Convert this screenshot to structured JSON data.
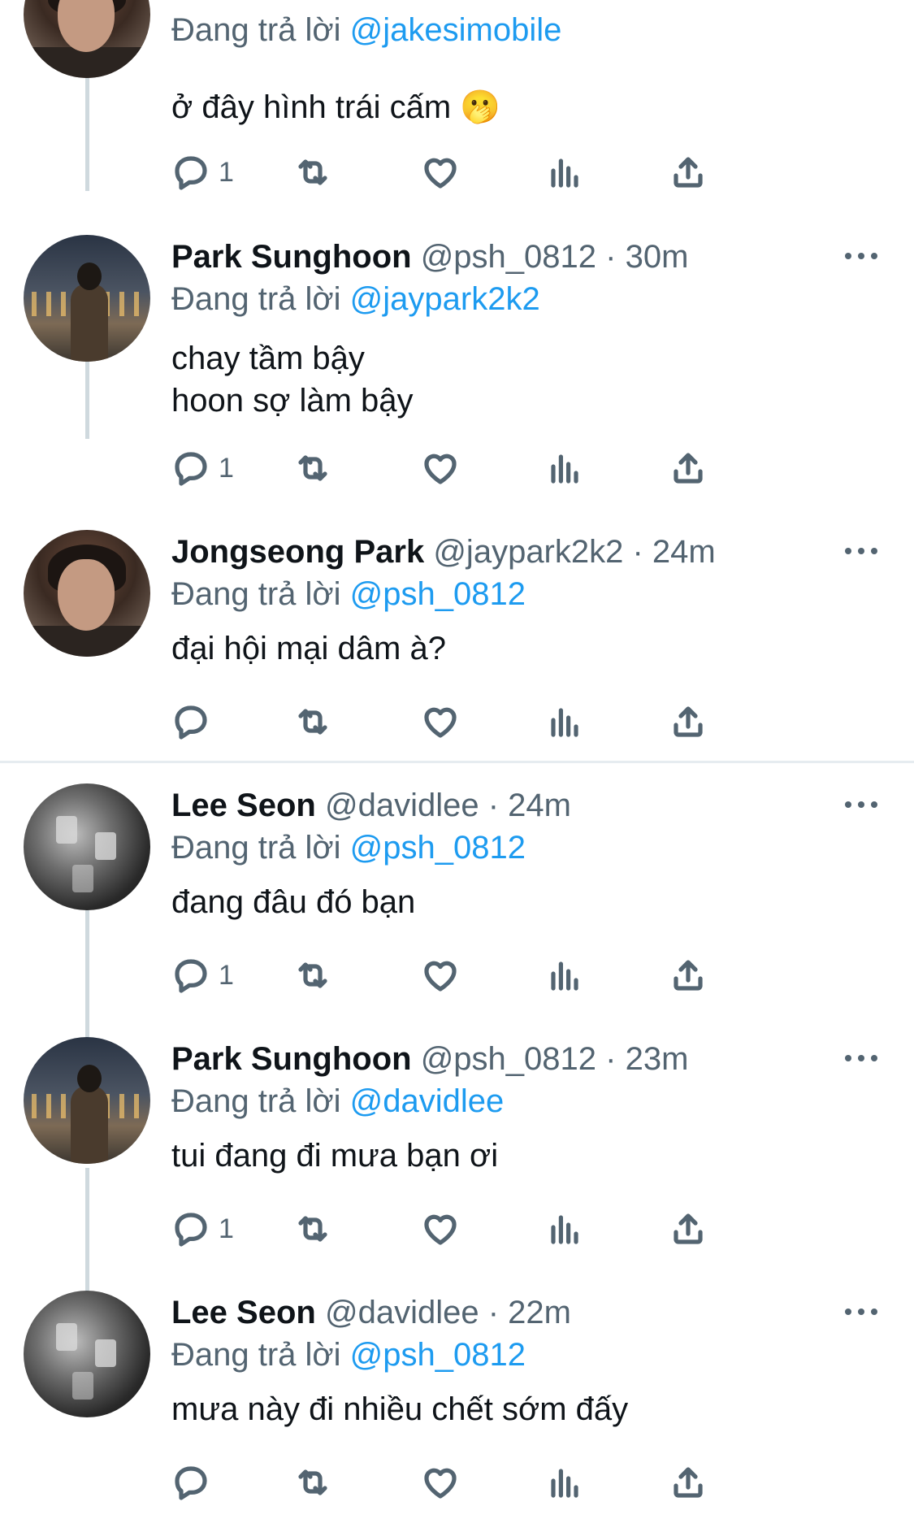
{
  "reply_prefix": "Đang trả lời",
  "colors": {
    "link": "#1d9bf0",
    "muted": "#536471",
    "text": "#0f1419",
    "divider": "#e6ecf0"
  },
  "icons": [
    "reply-icon",
    "retweet-icon",
    "like-icon",
    "analytics-icon",
    "share-icon",
    "more-icon"
  ],
  "tweets": [
    {
      "reply_to": "@jakesimobile",
      "text": "ở đây hình trái cấm 🫢",
      "reply_count": "1"
    },
    {
      "name": "Park Sunghoon",
      "handle": "@psh_0812",
      "time": "· 30m",
      "reply_to": "@jaypark2k2",
      "text": "chay tầm bậy\nhoon sợ làm bậy",
      "reply_count": "1"
    },
    {
      "name": "Jongseong Park",
      "handle": "@jaypark2k2",
      "time": "· 24m",
      "reply_to": "@psh_0812",
      "text": "đại hội mại dâm à?",
      "reply_count": ""
    },
    {
      "name": "Lee Seon",
      "handle": "@davidlee",
      "time": "· 24m",
      "reply_to": "@psh_0812",
      "text": "đang đâu đó bạn",
      "reply_count": "1"
    },
    {
      "name": "Park Sunghoon",
      "handle": "@psh_0812",
      "time": "· 23m",
      "reply_to": "@davidlee",
      "text": "tui đang đi mưa bạn ơi",
      "reply_count": "1"
    },
    {
      "name": "Lee Seon",
      "handle": "@davidlee",
      "time": "· 22m",
      "reply_to": "@psh_0812",
      "text": "mưa này đi nhiều chết sớm đấy",
      "reply_count": ""
    }
  ]
}
